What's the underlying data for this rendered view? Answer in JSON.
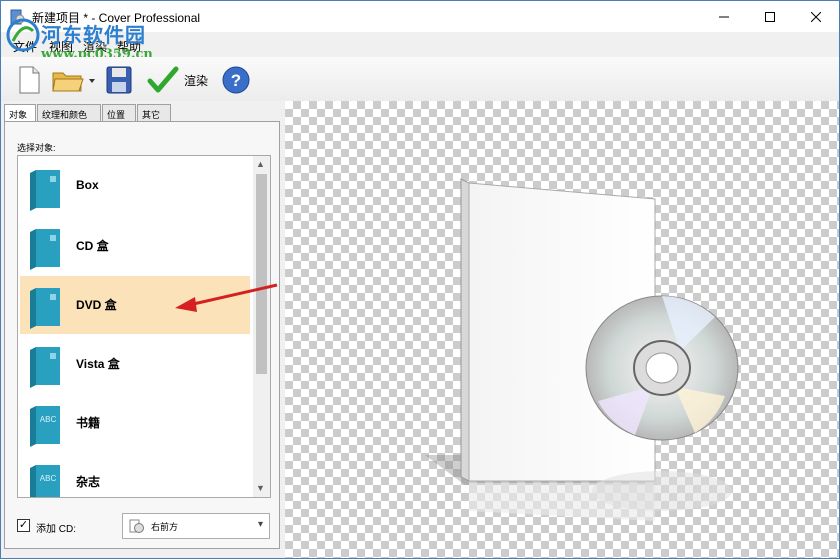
{
  "window": {
    "title": "新建项目 * - Cover Professional",
    "minimize_icon": "minimize-icon",
    "maximize_icon": "maximize-icon",
    "close_icon": "close-icon"
  },
  "watermark": {
    "title": "河东软件园",
    "url": "www.pc0359.cn"
  },
  "menu": [
    "文件",
    "视图",
    "渲染",
    "帮助"
  ],
  "toolbar": {
    "new_icon": "new-document-icon",
    "open_icon": "open-folder-icon",
    "save_icon": "save-disk-icon",
    "render_icon": "checkmark-icon",
    "render_label": "渲染",
    "help_icon": "help-icon"
  },
  "tabs": [
    "对象",
    "纹理和颜色",
    "位置",
    "其它"
  ],
  "panel": {
    "choose_label": "选择对象:",
    "items": [
      {
        "label": "Box",
        "icon": "box-icon"
      },
      {
        "label": "CD 盒",
        "icon": "cd-case-icon"
      },
      {
        "label": "DVD 盒",
        "icon": "dvd-case-icon",
        "selected": true
      },
      {
        "label": "Vista 盒",
        "icon": "vista-box-icon"
      },
      {
        "label": "书籍",
        "icon": "book-icon",
        "badge": "ABC"
      },
      {
        "label": "杂志",
        "icon": "magazine-icon",
        "badge": "ABC"
      }
    ],
    "add_cd_label": "添加 CD:",
    "add_cd_checked": true,
    "cd_position": "右前方"
  },
  "colors": {
    "selection": "#fbe2b8",
    "arrow": "#d42020",
    "book_teal": "#2aa0c0"
  }
}
